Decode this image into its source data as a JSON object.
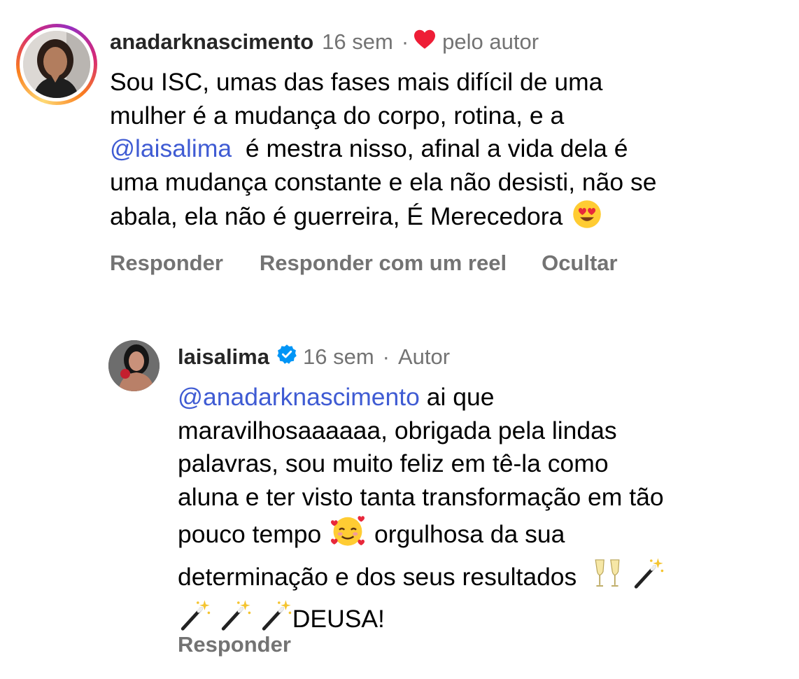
{
  "comments": [
    {
      "username": "anadarknascimento",
      "time": "16 sem",
      "separator": "·",
      "liked_by": "pelo autor",
      "lines": [
        "Sou ISC, umas das fases mais difícil de uma",
        "mulher é a mudança do corpo, rotina, e a",
        "é mestra nisso, afinal a vida dela é",
        "uma mudança constante e ela não desisti, não se",
        "abala,  ela não é guerreira, É Merecedora"
      ],
      "mention": "@laisalima",
      "actions": {
        "reply": "Responder",
        "reply_reel": "Responder com um reel",
        "hide": "Ocultar"
      }
    },
    {
      "username": "laisalima",
      "time": "16 sem",
      "separator": "·",
      "role": "Autor",
      "mention": "@anadarknascimento",
      "lines": [
        " ai que",
        "maravilhosaaaaaa, obrigada pela lindas",
        "palavras, sou muito feliz em tê-la como",
        "aluna e ter visto tanta transformação em tão",
        "pouco tempo",
        "orgulhosa da sua",
        "determinação e dos seus resultados",
        "DEUSA!"
      ],
      "actions": {
        "reply": "Responder"
      }
    }
  ],
  "icons": {
    "heart": "heart-icon",
    "verified": "verified-badge-icon",
    "heart_eyes": "heart-eyes-emoji",
    "smiling_hearts": "smiling-face-with-hearts-emoji",
    "champagne": "clinking-glasses-emoji",
    "wand": "magic-wand-emoji"
  },
  "colors": {
    "mention": "#3f5bd3",
    "meta": "#737373",
    "heart": "#ee1d36",
    "verified": "#0095f6"
  }
}
